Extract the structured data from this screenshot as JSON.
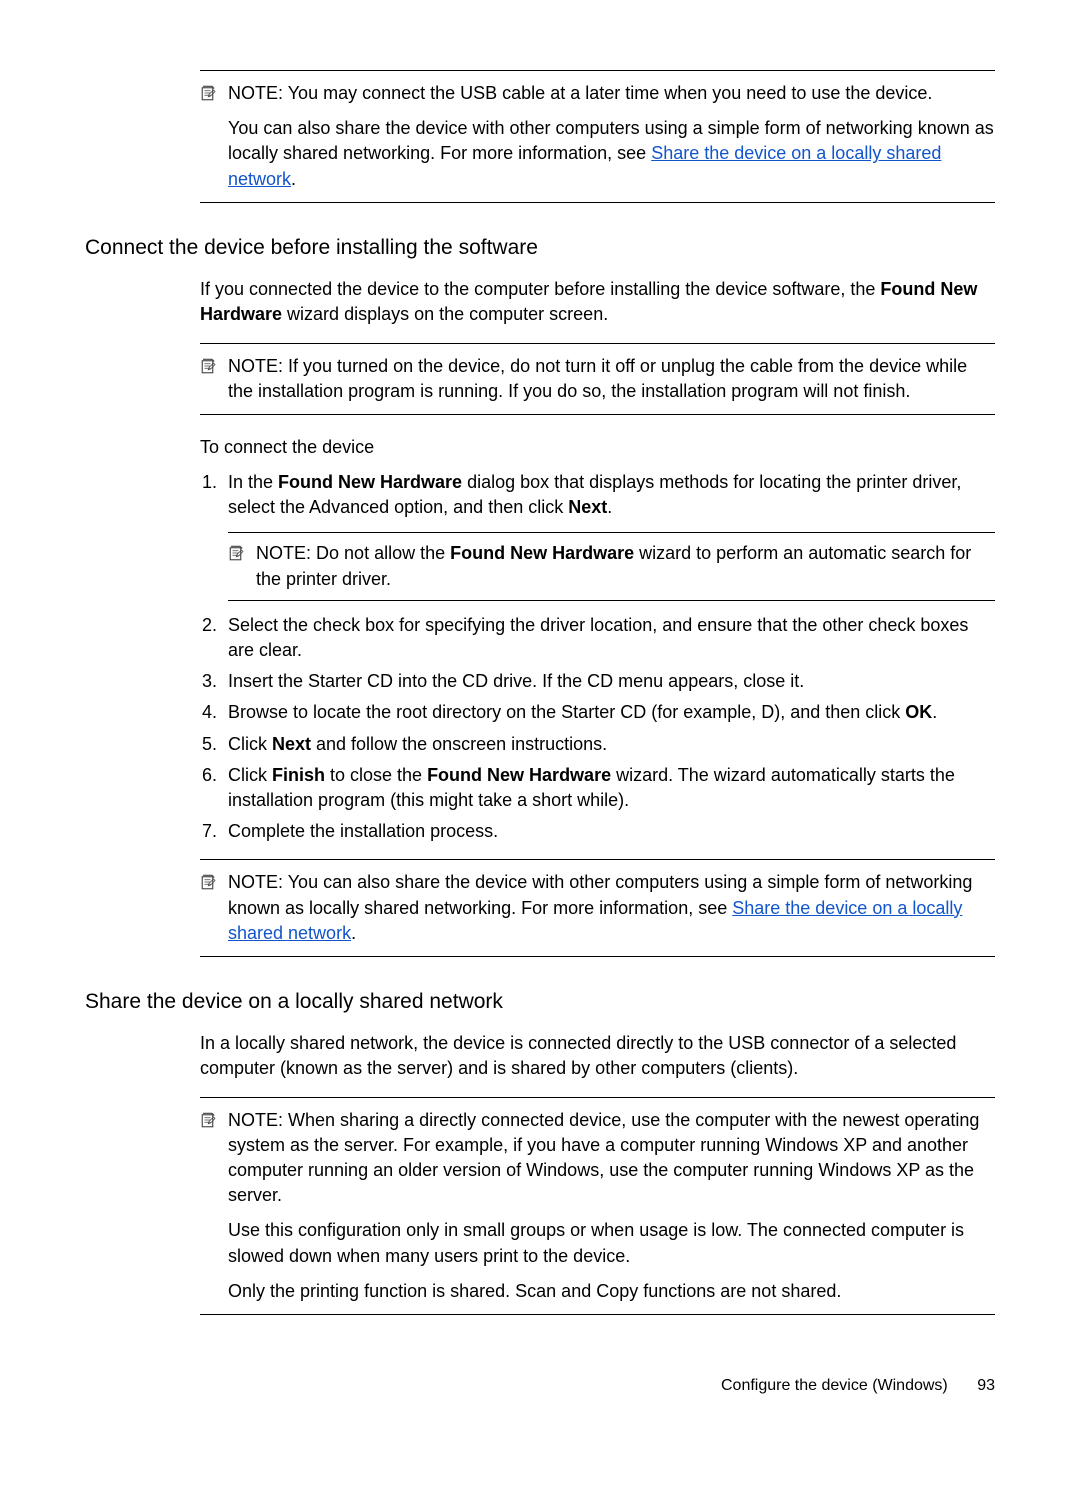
{
  "note1": {
    "label": "NOTE:",
    "text1a": "You may connect the USB cable at a later time when you need to use the device.",
    "text1b_start": "You can also share the device with other computers using a simple form of networking known as locally shared networking. For more information, see ",
    "link1": "Share the device on a locally shared network",
    "text1b_end": "."
  },
  "section1": {
    "heading": "Connect the device before installing the software",
    "para1_a": "If you connected the device to the computer before installing the device software, the ",
    "para1_b": "Found New Hardware",
    "para1_c": " wizard displays on the computer screen."
  },
  "note2": {
    "label": "NOTE:",
    "text": "If you turned on the device, do not turn it off or unplug the cable from the device while the installation program is running. If you do so, the installation program will not finish."
  },
  "sub_heading": "To connect the device",
  "steps": {
    "s1a": "In the ",
    "s1b": "Found New Hardware",
    "s1c": " dialog box that displays methods for locating the printer driver, select the Advanced option, and then click ",
    "s1d": "Next",
    "s1e": ".",
    "s1_note_label": "NOTE:",
    "s1_note_a": "Do not allow the ",
    "s1_note_b": "Found New Hardware",
    "s1_note_c": " wizard to perform an automatic search for the printer driver.",
    "s2": "Select the check box for specifying the driver location, and ensure that the other check boxes are clear.",
    "s3": "Insert the Starter CD into the CD drive. If the CD menu appears, close it.",
    "s4a": "Browse to locate the root directory on the Starter CD (for example, D), and then click ",
    "s4b": "OK",
    "s4c": ".",
    "s5a": "Click ",
    "s5b": "Next",
    "s5c": " and follow the onscreen instructions.",
    "s6a": "Click ",
    "s6b": "Finish",
    "s6c": " to close the ",
    "s6d": "Found New Hardware",
    "s6e": " wizard. The wizard automatically starts the installation program (this might take a short while).",
    "s7": "Complete the installation process."
  },
  "note3": {
    "label": "NOTE:",
    "text_start": "You can also share the device with other computers using a simple form of networking known as locally shared networking. For more information, see ",
    "link": "Share the device on a locally shared network",
    "text_end": "."
  },
  "section2": {
    "heading": "Share the device on a locally shared network",
    "para": "In a locally shared network, the device is connected directly to the USB connector of a selected computer (known as the server) and is shared by other computers (clients)."
  },
  "note4": {
    "label": "NOTE:",
    "text1": "When sharing a directly connected device, use the computer with the newest operating system as the server. For example, if you have a computer running Windows XP and another computer running an older version of Windows, use the computer running Windows XP as the server.",
    "text2": "Use this configuration only in small groups or when usage is low. The connected computer is slowed down when many users print to the device.",
    "text3": "Only the printing function is shared. Scan and Copy functions are not shared."
  },
  "footer": {
    "text": "Configure the device (Windows)",
    "page": "93"
  }
}
